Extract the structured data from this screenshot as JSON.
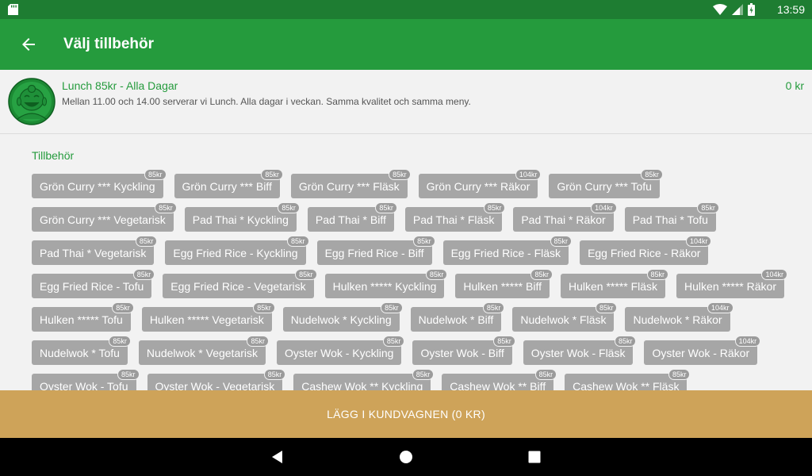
{
  "status_bar": {
    "time": "13:59"
  },
  "app_bar": {
    "title": "Välj tillbehör"
  },
  "product": {
    "name": "Lunch 85kr - Alla Dagar",
    "description": "Mellan 11.00 och 14.00 serverar vi Lunch. Alla dagar i veckan. Samma kvalitet och samma meny.",
    "price": "0 kr"
  },
  "options": {
    "heading": "Tillbehör",
    "items": [
      {
        "label": "Grön Curry *** Kyckling",
        "price": "85kr"
      },
      {
        "label": "Grön Curry *** Biff",
        "price": "85kr"
      },
      {
        "label": "Grön Curry *** Fläsk",
        "price": "85kr"
      },
      {
        "label": "Grön Curry *** Räkor",
        "price": "104kr"
      },
      {
        "label": "Grön Curry *** Tofu",
        "price": "85kr"
      },
      {
        "label": "Grön Curry *** Vegetarisk",
        "price": "85kr"
      },
      {
        "label": "Pad Thai * Kyckling",
        "price": "85kr"
      },
      {
        "label": "Pad Thai * Biff",
        "price": "85kr"
      },
      {
        "label": "Pad Thai * Fläsk",
        "price": "85kr"
      },
      {
        "label": "Pad Thai * Räkor",
        "price": "104kr"
      },
      {
        "label": "Pad Thai * Tofu",
        "price": "85kr"
      },
      {
        "label": "Pad Thai * Vegetarisk",
        "price": "85kr"
      },
      {
        "label": "Egg Fried Rice - Kyckling",
        "price": "85kr"
      },
      {
        "label": "Egg Fried Rice - Biff",
        "price": "85kr"
      },
      {
        "label": "Egg Fried Rice - Fläsk",
        "price": "85kr"
      },
      {
        "label": "Egg Fried Rice - Räkor",
        "price": "104kr"
      },
      {
        "label": "Egg Fried Rice - Tofu",
        "price": "85kr"
      },
      {
        "label": "Egg Fried Rice - Vegetarisk",
        "price": "85kr"
      },
      {
        "label": "Hulken ***** Kyckling",
        "price": "85kr"
      },
      {
        "label": "Hulken ***** Biff",
        "price": "85kr"
      },
      {
        "label": "Hulken ***** Fläsk",
        "price": "85kr"
      },
      {
        "label": "Hulken ***** Räkor",
        "price": "104kr"
      },
      {
        "label": "Hulken ***** Tofu",
        "price": "85kr"
      },
      {
        "label": "Hulken ***** Vegetarisk",
        "price": "85kr"
      },
      {
        "label": "Nudelwok * Kyckling",
        "price": "85kr"
      },
      {
        "label": "Nudelwok * Biff",
        "price": "85kr"
      },
      {
        "label": "Nudelwok * Fläsk",
        "price": "85kr"
      },
      {
        "label": "Nudelwok * Räkor",
        "price": "104kr"
      },
      {
        "label": "Nudelwok * Tofu",
        "price": "85kr"
      },
      {
        "label": "Nudelwok * Vegetarisk",
        "price": "85kr"
      },
      {
        "label": "Oyster Wok - Kyckling",
        "price": "85kr"
      },
      {
        "label": "Oyster Wok - Biff",
        "price": "85kr"
      },
      {
        "label": "Oyster Wok - Fläsk",
        "price": "85kr"
      },
      {
        "label": "Oyster Wok - Räkor",
        "price": "104kr"
      },
      {
        "label": "Oyster Wok - Tofu",
        "price": "85kr"
      },
      {
        "label": "Oyster Wok - Vegetarisk",
        "price": "85kr"
      },
      {
        "label": "Cashew Wok ** Kyckling",
        "price": "85kr"
      },
      {
        "label": "Cashew Wok ** Biff",
        "price": "85kr"
      },
      {
        "label": "Cashew Wok ** Fläsk",
        "price": "85kr"
      }
    ]
  },
  "cart_button": {
    "label": "LÄGG I KUNDVAGNEN (0 KR)"
  },
  "colors": {
    "primary": "#259b3d",
    "primary_dark": "#1e7d32",
    "chip": "#a6a6a6",
    "cart": "#cea359"
  },
  "icons": {
    "status": [
      "sd-card-icon",
      "wifi-icon",
      "signal-icon",
      "battery-icon"
    ],
    "app_bar": "arrow-back-icon",
    "nav": [
      "nav-back-icon",
      "nav-home-icon",
      "nav-recents-icon"
    ]
  }
}
